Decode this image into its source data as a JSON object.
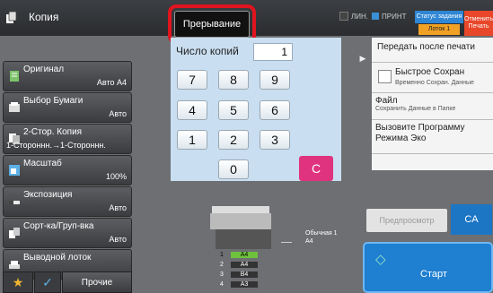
{
  "header": {
    "app_title": "Копия",
    "interrupt_label": "Прерывание",
    "line_label": "ЛИН.",
    "print_label": "ПРИНТ",
    "job_status_label": "Статус задания",
    "job_status_sub": "Лоток 1",
    "cancel_print_label": "Отменить Печать"
  },
  "left_menu": [
    {
      "title": "Оригинал",
      "value": "Авто A4",
      "icon": "original-icon"
    },
    {
      "title": "Выбор Бумаги",
      "value": "Авто",
      "icon": "paper-select-icon"
    },
    {
      "title": "2-Стор. Копия",
      "value": "1-Стороннн.→1-Стороннн.",
      "icon": "duplex-icon"
    },
    {
      "title": "Масштаб",
      "value": "100%",
      "icon": "scale-icon"
    },
    {
      "title": "Экспозиция",
      "value": "Авто",
      "icon": "exposure-icon"
    },
    {
      "title": "Сорт-ка/Груп-вка",
      "value": "Авто",
      "icon": "sort-icon"
    },
    {
      "title": "Выводной лоток",
      "value": "",
      "icon": "output-tray-icon"
    }
  ],
  "bottom_left": {
    "other_label": "Прочие"
  },
  "keypad": {
    "count_label": "Число копий",
    "count_value": "1",
    "keys": [
      "7",
      "8",
      "9",
      "4",
      "5",
      "6",
      "1",
      "2",
      "3",
      "0"
    ],
    "clear_label": "C"
  },
  "right_panel": {
    "send_after_print": "Передать после печати",
    "quick_save_title": "Быстрое Сохран",
    "quick_save_sub": "Временно Сохран. Данные",
    "file_title": "Файл",
    "file_sub": "Сохранить Данные в Папке",
    "eco_program": "Вызовите Программу Режима Эко"
  },
  "paper": {
    "tray_note_1": "Обычная 1",
    "tray_note_2": "A4",
    "trays": [
      {
        "num": "1",
        "size": "A4"
      },
      {
        "num": "2",
        "size": "A4"
      },
      {
        "num": "3",
        "size": "B4"
      },
      {
        "num": "4",
        "size": "A3"
      }
    ]
  },
  "actions": {
    "preview_label": "Предпросмотр",
    "ca_label": "CA",
    "start_label": "Старт"
  }
}
